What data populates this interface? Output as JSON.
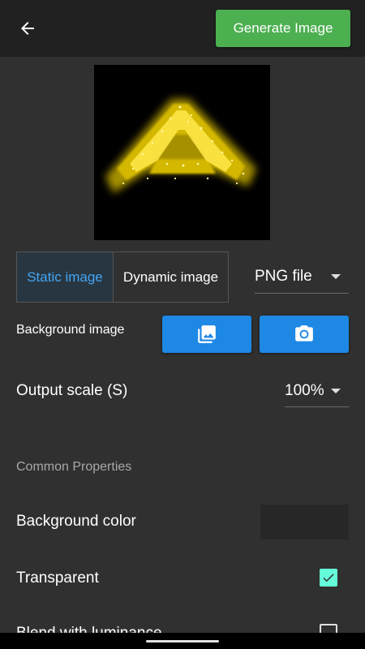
{
  "header": {
    "back_icon": "arrow-back-icon",
    "generate_label": "Generate Image"
  },
  "preview": {
    "letter": "A",
    "glow_color": "#ffe000"
  },
  "mode": {
    "options": [
      "Static image",
      "Dynamic image"
    ],
    "selected": "Static image"
  },
  "file_type": {
    "value": "PNG file"
  },
  "background_image": {
    "label": "Background image",
    "gallery_icon": "photo-library-icon",
    "camera_icon": "camera-icon"
  },
  "output_scale": {
    "label": "Output scale (S)",
    "value": "100%"
  },
  "common": {
    "section_title": "Common Properties",
    "background_color_label": "Background color",
    "background_color_value": "#272727",
    "transparent_label": "Transparent",
    "transparent_checked": true,
    "blend_label": "Blend with luminance",
    "blend_checked": false
  },
  "colors": {
    "accent_green": "#4caf50",
    "accent_blue": "#1e88e5",
    "selected_text": "#42a5f5",
    "checkbox_teal": "#64ffda"
  }
}
